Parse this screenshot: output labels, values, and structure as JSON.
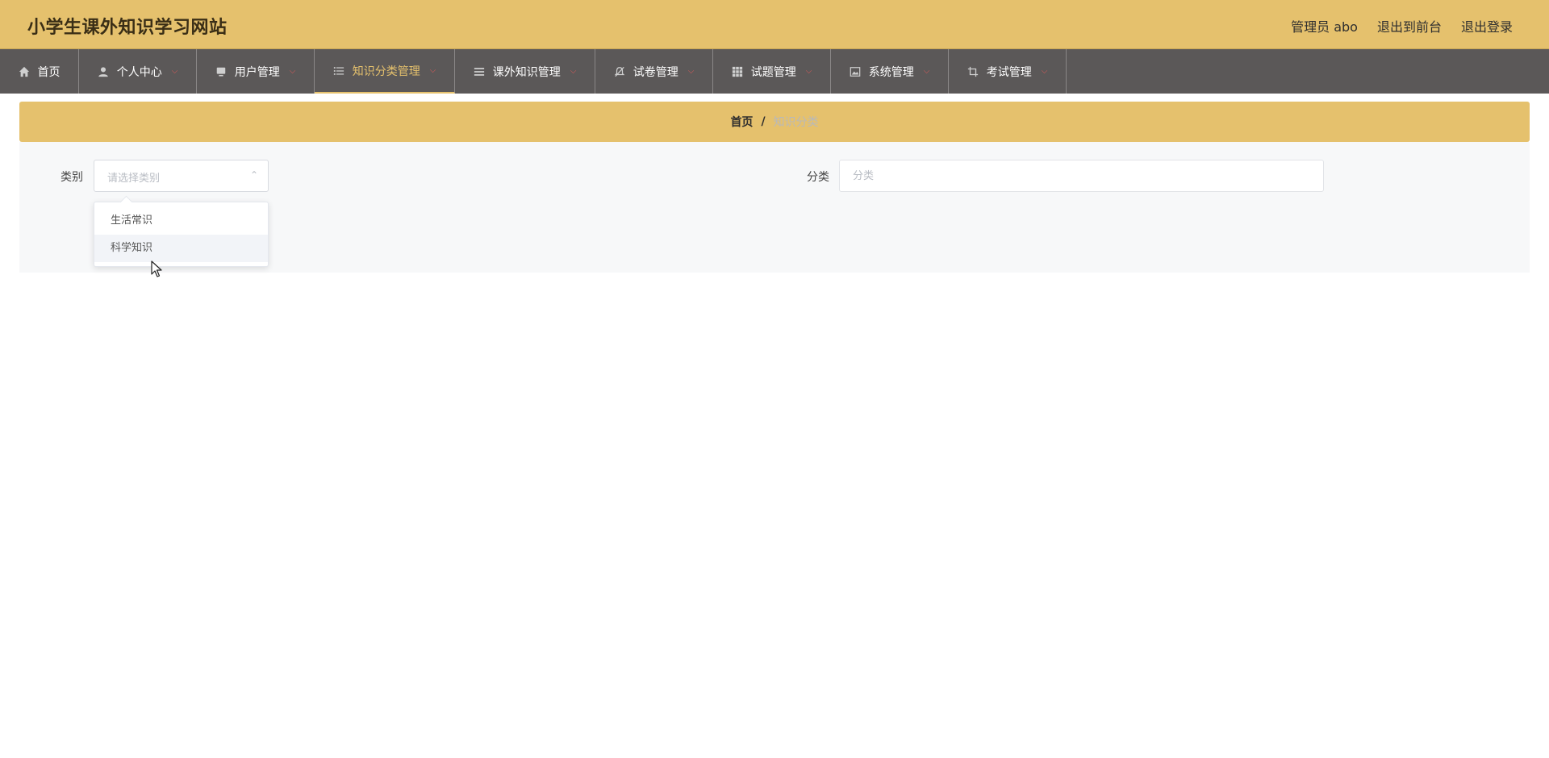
{
  "header": {
    "site_title": "小学生课外知识学习网站",
    "admin_label": "管理员 abo",
    "exit_front_label": "退出到前台",
    "logout_label": "退出登录",
    "accent_color": "#e5c16d"
  },
  "nav": {
    "items": [
      {
        "label": "首页",
        "icon": "home-icon"
      },
      {
        "label": "个人中心",
        "icon": "user-icon"
      },
      {
        "label": "用户管理",
        "icon": "monitor-icon"
      },
      {
        "label": "知识分类管理",
        "icon": "list-icon",
        "active": true
      },
      {
        "label": "课外知识管理",
        "icon": "menu-lines-icon"
      },
      {
        "label": "试卷管理",
        "icon": "bell-off-icon"
      },
      {
        "label": "试题管理",
        "icon": "grid-icon"
      },
      {
        "label": "系统管理",
        "icon": "picture-icon"
      },
      {
        "label": "考试管理",
        "icon": "crop-icon"
      }
    ]
  },
  "breadcrumb": {
    "home": "首页",
    "separator": "/",
    "current": "知识分类"
  },
  "search": {
    "category_label": "类别",
    "category_placeholder": "请选择类别",
    "classify_label": "分类",
    "classify_placeholder": "分类"
  },
  "dropdown": {
    "options": [
      "生活常识",
      "科学知识"
    ],
    "hovered_index": 1
  }
}
